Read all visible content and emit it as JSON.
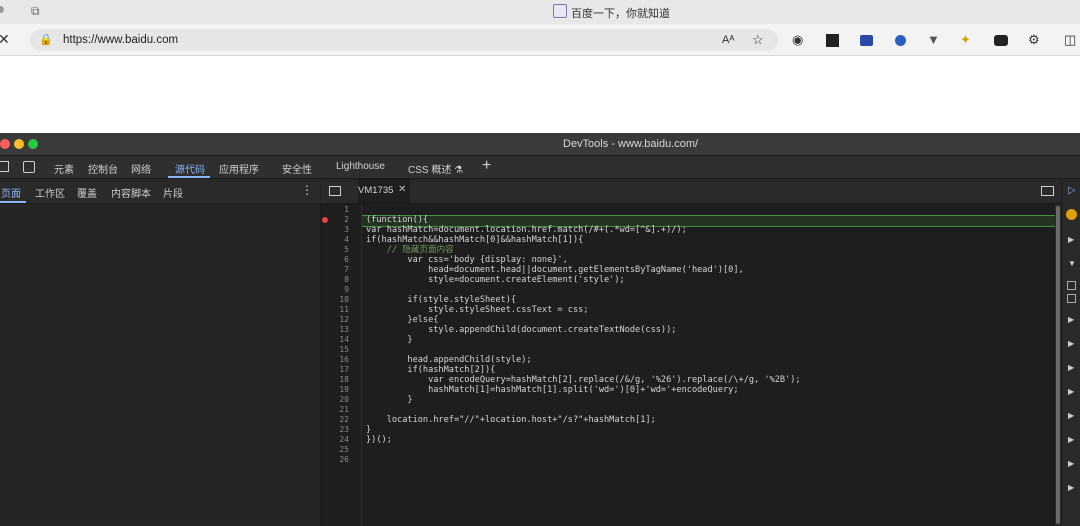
{
  "browser": {
    "tab_title": "百度一下，你就知道",
    "url": "https://www.baidu.com",
    "icons": [
      "read-aloud-icon",
      "favorite-icon",
      "ext-circle-icon",
      "ext-chart-icon",
      "ext-card-icon",
      "ext-blue-icon",
      "ext-v-icon",
      "ext-bee-icon",
      "ext-mask-icon",
      "extensions-icon",
      "split-icon"
    ]
  },
  "devtools": {
    "title": "DevTools - www.baidu.com/",
    "tabs": [
      "元素",
      "控制台",
      "网络",
      "源代码",
      "应用程序",
      "安全性",
      "Lighthouse",
      "CSS 概述 ⚗"
    ],
    "active_tab": "源代码",
    "nav_tabs": [
      "页面",
      "工作区",
      "覆盖",
      "内容脚本",
      "片段"
    ],
    "active_nav_tab": "页面",
    "file_tab": "VM1735",
    "breakpoint_line": 2,
    "line_numbers": [
      "1",
      "2",
      "3",
      "4",
      "5",
      "6",
      "7",
      "8",
      "9",
      "10",
      "11",
      "12",
      "13",
      "14",
      "15",
      "16",
      "17",
      "18",
      "19",
      "20",
      "21",
      "22",
      "23",
      "24",
      "25",
      "26"
    ],
    "code": [
      "",
      "(function(){",
      "var hashMatch=document.location.href.match(/#+(.*wd=[^&].+)/);",
      "if(hashMatch&&hashMatch[0]&&hashMatch[1]){",
      "    // 隐藏页面内容",
      "        var css='body {display: none}',",
      "            head=document.head||document.getElementsByTagName('head')[0],",
      "            style=document.createElement('style');",
      "",
      "        if(style.styleSheet){",
      "            style.styleSheet.cssText = css;",
      "        }else{",
      "            style.appendChild(document.createTextNode(css));",
      "        }",
      "",
      "        head.appendChild(style);",
      "        if(hashMatch[2]){",
      "            var encodeQuery=hashMatch[2].replace(/&/g, '%26').replace(/\\+/g, '%2B');",
      "            hashMatch[1]=hashMatch[1].split('wd=')[0]+'wd='+encodeQuery;",
      "        }",
      "",
      "    location.href=\"//\"+location.host+\"/s?\"+hashMatch[1];",
      "}",
      "})();",
      "",
      ""
    ]
  }
}
